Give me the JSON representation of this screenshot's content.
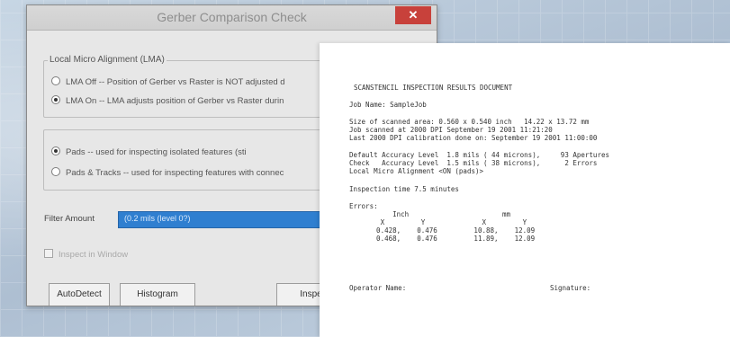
{
  "dialog": {
    "title": "Gerber Comparison Check",
    "close_glyph": "✕",
    "lma_group": {
      "title": "Local Micro Alignment (LMA)",
      "options": [
        "LMA Off -- Position of Gerber vs Raster is NOT adjusted d",
        "LMA On -- LMA adjusts position of Gerber vs Raster durin"
      ],
      "selected_index": 1
    },
    "mode_group": {
      "options": [
        "Pads             -- used for inspecting isolated features (sti",
        "Pads & Tracks -- used for inspecting features with connec"
      ],
      "selected_index": 0
    },
    "filter": {
      "label": "Filter Amount",
      "value": "(0.2 mils (level 0?)"
    },
    "inspect_window_label": "Inspect in Window",
    "buttons": {
      "autodetect": "AutoDetect",
      "histogram": "Histogram",
      "inspect": "Inspec"
    }
  },
  "document": {
    "title": "SCANSTENCIL INSPECTION RESULTS DOCUMENT",
    "job_name": "Job Name: SampleJob",
    "size_line": "Size of scanned area: 0.560 x 0.540 inch   14.22 x 13.72 mm",
    "scanned_line": "Job scanned at 2000 DPI September 19 2001 11:21:20",
    "calibration_line": "Last 2000 DPI calibration done on: September 19 2001 11:00:00",
    "default_accuracy_line": "Default Accuracy Level  1.8 mils ( 44 microns),     93 Apertures",
    "check_accuracy_line": "Check   Accuracy Level  1.5 mils ( 38 microns),      2 Errors",
    "lma_line": "Local Micro Alignment <ON (pads)>",
    "inspection_time": "Inspection time 7.5 minutes",
    "errors_label": "Errors:",
    "errors_header_units": "        Inch                       mm",
    "errors_header_axes": "     X         Y              X         Y",
    "error_rows": [
      "    0.428,    0.476         10.88,    12.09",
      "    0.468,    0.476         11.89,    12.09"
    ],
    "operator_label": "Operator Name:",
    "signature_label": "Signature:"
  }
}
